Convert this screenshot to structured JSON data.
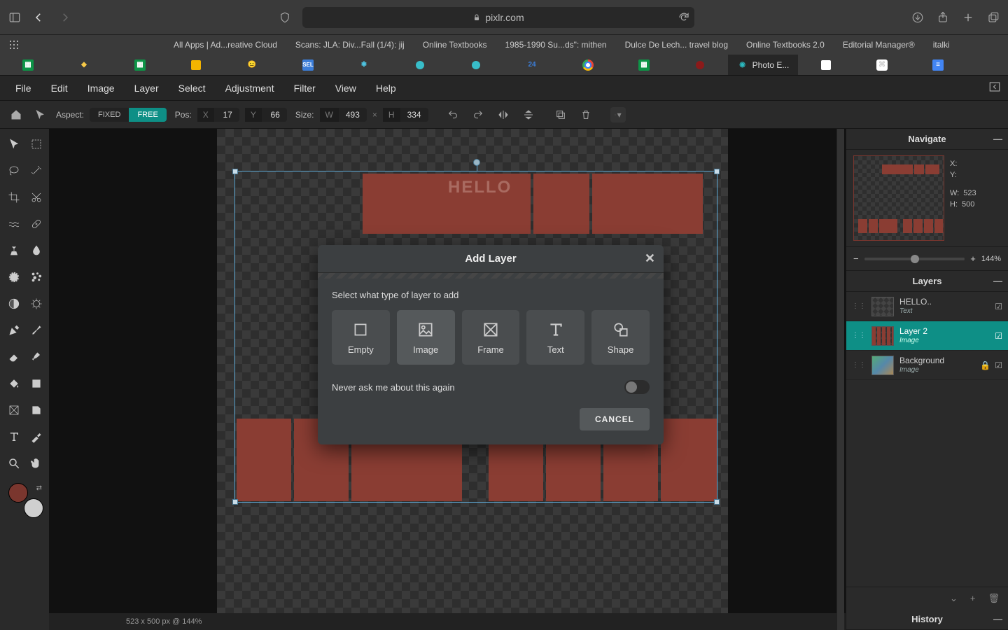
{
  "browser": {
    "url_host": "pixlr.com",
    "bookmarks": [
      "All Apps | Ad...reative Cloud",
      "Scans: JLA: Div...Fall (1/4): jij",
      "Online Textbooks",
      "1985-1990 Su...ds\": mithen",
      "Dulce De Lech... travel blog",
      "Online Textbooks 2.0",
      "Editorial Manager®",
      "italki"
    ],
    "active_tab_label": "Photo E..."
  },
  "menu": {
    "items": [
      "File",
      "Edit",
      "Image",
      "Layer",
      "Select",
      "Adjustment",
      "Filter",
      "View",
      "Help"
    ]
  },
  "optbar": {
    "aspect_label": "Aspect:",
    "aspect_fixed": "FIXED",
    "aspect_free": "FREE",
    "pos_label": "Pos:",
    "pos_x": "17",
    "pos_y": "66",
    "size_label": "Size:",
    "size_w": "493",
    "size_h": "334"
  },
  "canvas": {
    "text": "HELLO"
  },
  "status": {
    "text": "523 x 500 px @ 144%"
  },
  "navigate": {
    "title": "Navigate",
    "x_label": "X:",
    "y_label": "Y:",
    "w_label": "W:",
    "w": "523",
    "h_label": "H:",
    "h": "500",
    "zoom": "144%"
  },
  "layers": {
    "title": "Layers",
    "items": [
      {
        "name": "HELLO..",
        "sub": "Text"
      },
      {
        "name": "Layer 2",
        "sub": "Image"
      },
      {
        "name": "Background",
        "sub": "Image"
      }
    ],
    "history_title": "History"
  },
  "dialog": {
    "title": "Add Layer",
    "sub": "Select what type of layer to add",
    "opts": {
      "empty": "Empty",
      "image": "Image",
      "frame": "Frame",
      "text": "Text",
      "shape": "Shape"
    },
    "never": "Never ask me about this again",
    "cancel": "CANCEL"
  }
}
